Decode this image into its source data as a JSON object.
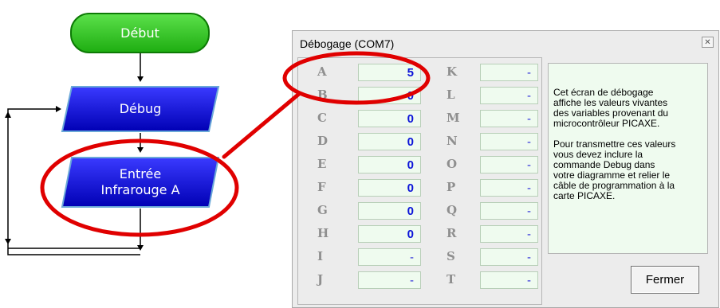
{
  "flowchart": {
    "start_label": "Début",
    "debug_label": "Débug",
    "input_label_line1": "Entrée",
    "input_label_line2": "Infrarouge A"
  },
  "debug_window": {
    "title": "Débogage (COM7)",
    "close_glyph": "✕",
    "variables_left": [
      {
        "name": "A",
        "value": "5"
      },
      {
        "name": "B",
        "value": "0"
      },
      {
        "name": "C",
        "value": "0"
      },
      {
        "name": "D",
        "value": "0"
      },
      {
        "name": "E",
        "value": "0"
      },
      {
        "name": "F",
        "value": "0"
      },
      {
        "name": "G",
        "value": "0"
      },
      {
        "name": "H",
        "value": "0"
      },
      {
        "name": "I",
        "value": "-"
      },
      {
        "name": "J",
        "value": "-"
      }
    ],
    "variables_right": [
      {
        "name": "K",
        "value": "-"
      },
      {
        "name": "L",
        "value": "-"
      },
      {
        "name": "M",
        "value": "-"
      },
      {
        "name": "N",
        "value": "-"
      },
      {
        "name": "O",
        "value": "-"
      },
      {
        "name": "P",
        "value": "-"
      },
      {
        "name": "Q",
        "value": "-"
      },
      {
        "name": "R",
        "value": "-"
      },
      {
        "name": "S",
        "value": "-"
      },
      {
        "name": "T",
        "value": "-"
      }
    ],
    "info_text": "Cet écran de débogage\naffiche les valeurs vivantes\ndes variables provenant du\nmicrocontrôleur PICAXE.\n\nPour transmettre ces valeurs\nvous devez inclure la\ncommande Debug dans\nvotre diagramme et relier le\ncâble de programmation à la\ncarte PICAXE.",
    "close_button": "Fermer"
  },
  "colors": {
    "start_green": "#2cc11c",
    "process_blue": "#0a0ac8",
    "highlight_red": "#e00000",
    "value_blue": "#0a12d8"
  }
}
